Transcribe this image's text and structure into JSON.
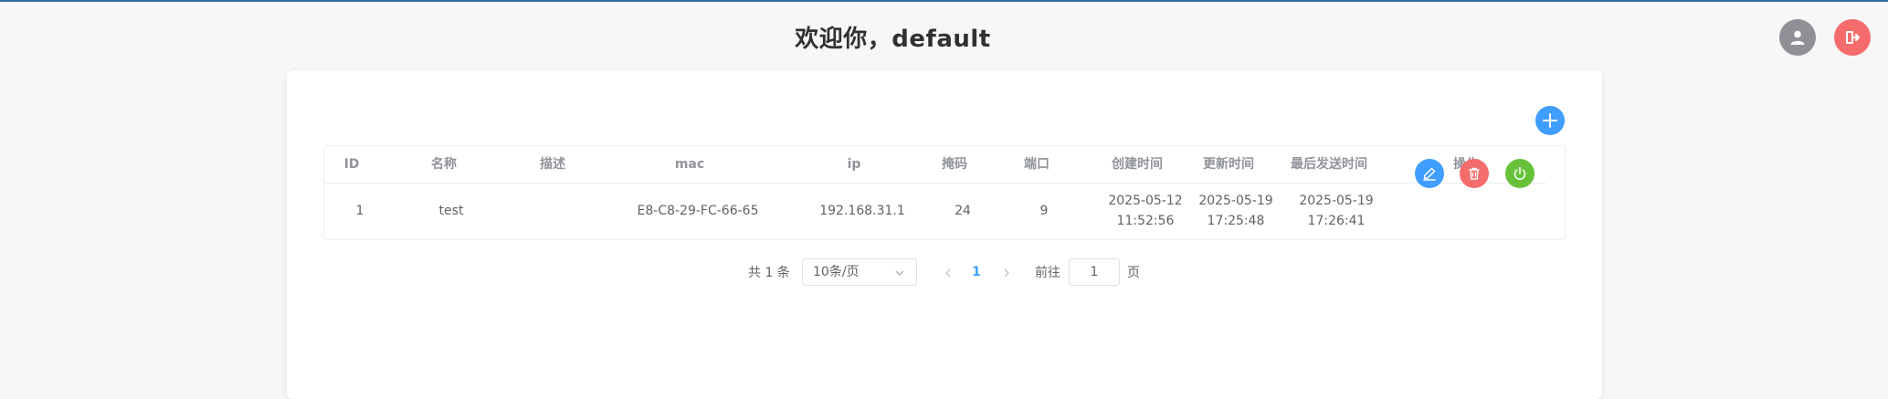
{
  "header": {
    "welcome": "欢迎你，default"
  },
  "icons": {
    "user": "user-icon",
    "logout": "logout-icon",
    "add": "plus-icon",
    "edit": "pen-icon",
    "delete": "trash-icon",
    "power": "power-icon"
  },
  "colors": {
    "primary": "#409eff",
    "danger": "#f56c6c",
    "success": "#67c23a",
    "neutral": "#8e9095"
  },
  "table": {
    "columns": [
      "ID",
      "名称",
      "描述",
      "mac",
      "ip",
      "掩码",
      "端口",
      "创建时间",
      "更新时间",
      "最后发送时间",
      "操作"
    ],
    "rows": [
      {
        "id": "1",
        "name": "test",
        "desc": "",
        "mac": "E8-C8-29-FC-66-65",
        "ip": "192.168.31.1",
        "mask": "24",
        "port": "9",
        "created_date": "2025-05-12",
        "created_time": "11:52:56",
        "updated_date": "2025-05-19",
        "updated_time": "17:25:48",
        "last_sent_date": "2025-05-19",
        "last_sent_time": "17:26:41"
      }
    ]
  },
  "pagination": {
    "total": "共 1 条",
    "page_size": "10条/页",
    "current_page": "1",
    "goto_label": "前往",
    "goto_value": "1",
    "page_suffix": "页"
  }
}
